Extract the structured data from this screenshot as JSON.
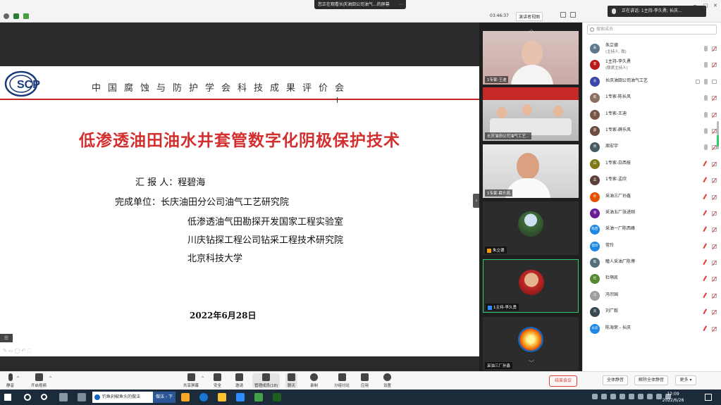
{
  "window": {
    "share_banner": "您正在观看长庆油田公司油气...的屏幕",
    "timer": "03:46:37",
    "view_label": "演讲者视图",
    "speaking": "正在讲话: 1主持-李久勇; 长庆..."
  },
  "slide": {
    "logo_text": "SCP",
    "org_name": "中国腐蚀与防护学会科技成果评价会",
    "title": "低渗透油田油水井套管数字化阴极保护技术",
    "reporter": "汇 报 人：程碧海",
    "unit_label": "完成单位：长庆油田分公司油气工艺研究院",
    "units": [
      "低渗透油气田勘探开发国家工程实验室",
      "川庆钻探工程公司钻采工程技术研究院",
      "北京科技大学"
    ],
    "date": "2022年6月28日"
  },
  "videos": [
    {
      "name": "1专家-王迪"
    },
    {
      "name": "长庆油田公司油气工艺..."
    },
    {
      "name": "1专家-薛乐风"
    },
    {
      "name": "朱立德"
    },
    {
      "name": "1主持-李久勇"
    },
    {
      "name": "采油三厂孙鑫"
    }
  ],
  "participants": {
    "search_placeholder": "搜索成员",
    "rows": [
      {
        "name": "朱立德",
        "sub": "(主持人, 我)",
        "avatar": "朱",
        "color": "#5d7a8c",
        "mic": "on",
        "cam": "off"
      },
      {
        "name": "1主持-李久勇",
        "sub": "(联席主持人)",
        "avatar": "李",
        "color": "#b71c1c",
        "mic": "on",
        "cam": "off"
      },
      {
        "name": "长庆油田公司油气工艺",
        "sub": "",
        "avatar": "长",
        "color": "#3949ab",
        "mic": "on",
        "cam": "on",
        "extra": true
      },
      {
        "name": "1专家-陈长风",
        "sub": "",
        "avatar": "陈",
        "color": "#8d6e63",
        "mic": "on",
        "cam": "off"
      },
      {
        "name": "1专家-王迪",
        "sub": "",
        "avatar": "王",
        "color": "#795548",
        "mic": "on",
        "cam": "off"
      },
      {
        "name": "1专家-薛乐风",
        "sub": "",
        "avatar": "薛",
        "color": "#6d4c41",
        "mic": "on",
        "cam": "off"
      },
      {
        "name": "周宏宇",
        "sub": "",
        "avatar": "周",
        "color": "#455a64",
        "mic": "on",
        "cam": "off"
      },
      {
        "name": "1专家-白西按",
        "sub": "",
        "avatar": "白",
        "color": "#827717",
        "mic": "muted",
        "cam": "off"
      },
      {
        "name": "1专家-孟欣",
        "sub": "",
        "avatar": "孟",
        "color": "#5d4037",
        "mic": "muted",
        "cam": "off"
      },
      {
        "name": "采油三厂孙鑫",
        "sub": "",
        "avatar": "孙",
        "color": "#e65100",
        "mic": "muted",
        "cam": "off"
      },
      {
        "name": "采油五厂张进刚",
        "sub": "",
        "avatar": "张",
        "color": "#6a1b9a",
        "mic": "muted",
        "cam": "off"
      },
      {
        "name": "采油一厂陈西峰",
        "sub": "",
        "avatar": "陈西",
        "color": "#1e88e5",
        "mic": "muted",
        "cam": "off"
      },
      {
        "name": "常玲",
        "sub": "",
        "avatar": "常玲",
        "color": "#1e88e5",
        "mic": "muted",
        "cam": "off"
      },
      {
        "name": "瞳人采油厂陈博",
        "sub": "",
        "avatar": "陈",
        "color": "#546e7a",
        "mic": "muted",
        "cam": "off"
      },
      {
        "name": "杜萌凯",
        "sub": "",
        "avatar": "杜",
        "color": "#558b2f",
        "mic": "muted",
        "cam": "off"
      },
      {
        "name": "冯宗国",
        "sub": "",
        "avatar": "冯",
        "color": "#9e9e9e",
        "mic": "muted",
        "cam": "off"
      },
      {
        "name": "刘广毅",
        "sub": "",
        "avatar": "刘",
        "color": "#37474f",
        "mic": "muted",
        "cam": "off"
      },
      {
        "name": "陈海荣 - 长庆",
        "sub": "",
        "avatar": "长庆",
        "color": "#1e88e5",
        "mic": "muted",
        "cam": "off"
      }
    ]
  },
  "toolbar": {
    "mute": "静音",
    "video": "开启视频",
    "share": "共享屏幕",
    "security": "安全",
    "invite": "邀请",
    "manage": "管理成员(18)",
    "chat": "聊天",
    "record": "录制",
    "breakout": "分组讨论",
    "apps": "应用",
    "settings": "设置",
    "end": "结束会议",
    "mute_all": "全体静音",
    "unmute_all": "解除全体静音",
    "more": "更多"
  },
  "taskbar": {
    "search": "钓鱼剁椒鱼头的做法",
    "cook": "做法 - 下",
    "time": "12:09",
    "date": "2022/6/28"
  }
}
